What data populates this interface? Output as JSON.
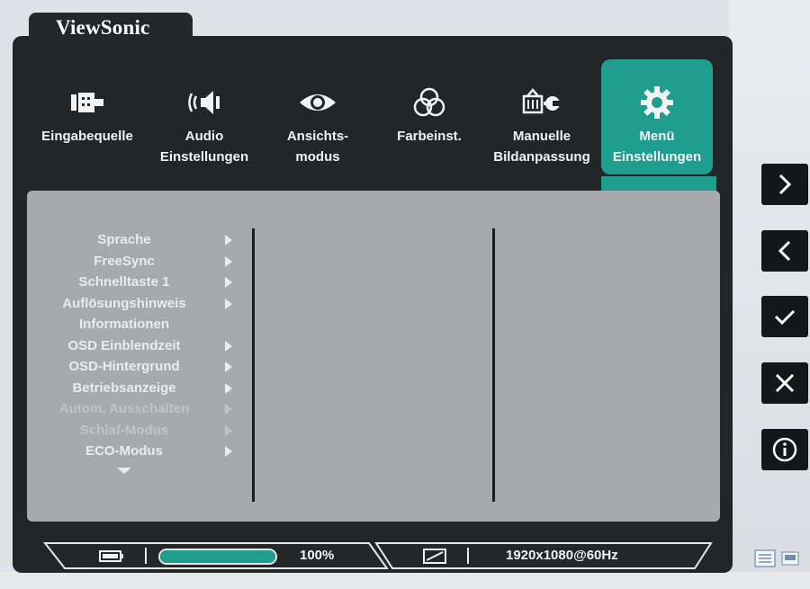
{
  "brand": "ViewSonic",
  "tabs": [
    {
      "label": "Eingabequelle",
      "icon": "input-source-icon"
    },
    {
      "label": "Audio\nEinstellungen",
      "icon": "speaker-icon"
    },
    {
      "label": "Ansichts-\nmodus",
      "icon": "eye-icon"
    },
    {
      "label": "Farbeinst.",
      "icon": "color-circles-icon"
    },
    {
      "label": "Manuelle\nBildanpassung",
      "icon": "monitor-wrench-icon"
    },
    {
      "label": "Menü\nEinstellungen",
      "icon": "gear-icon",
      "active": true
    }
  ],
  "menu": {
    "items": [
      {
        "label": "Sprache",
        "arrow": true,
        "dim": false
      },
      {
        "label": "FreeSync",
        "arrow": true,
        "dim": false
      },
      {
        "label": "Schnelltaste 1",
        "arrow": true,
        "dim": false
      },
      {
        "label": "Auflösungshinweis",
        "arrow": true,
        "dim": false
      },
      {
        "label": "Informationen",
        "arrow": false,
        "dim": false
      },
      {
        "label": "OSD Einblendzeit",
        "arrow": true,
        "dim": false
      },
      {
        "label": "OSD-Hintergrund",
        "arrow": true,
        "dim": false
      },
      {
        "label": "Betriebsanzeige",
        "arrow": true,
        "dim": false
      },
      {
        "label": "Autom. Ausschalten",
        "arrow": true,
        "dim": true
      },
      {
        "label": "Schlaf-Modus",
        "arrow": true,
        "dim": true
      },
      {
        "label": "ECO-Modus",
        "arrow": true,
        "dim": false
      }
    ]
  },
  "status": {
    "battery_percent": 100,
    "percent_text": "100%",
    "resolution_text": "1920x1080@60Hz"
  },
  "side_buttons": [
    {
      "name": "next-button",
      "icon": "chevron-right-icon"
    },
    {
      "name": "back-button",
      "icon": "chevron-left-icon"
    },
    {
      "name": "confirm-button",
      "icon": "check-icon"
    },
    {
      "name": "close-button",
      "icon": "close-icon"
    },
    {
      "name": "info-button",
      "icon": "info-icon"
    }
  ],
  "colors": {
    "osd_background": "#232527",
    "accent": "#1f9d8e",
    "panel": "#a8a9ab"
  }
}
